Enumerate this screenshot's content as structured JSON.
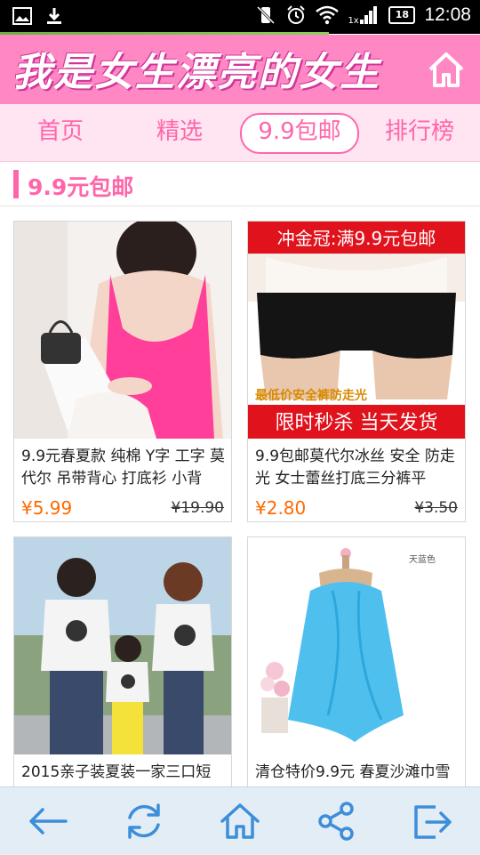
{
  "status_bar": {
    "time": "12:08",
    "battery": "18",
    "network_label": "1x",
    "icons": [
      "image-icon",
      "download-icon",
      "vibrate-off-icon",
      "alarm-icon",
      "wifi-icon",
      "signal-icon",
      "battery-icon"
    ]
  },
  "header": {
    "title": "我是女生漂亮的女生",
    "home_icon": "home-icon"
  },
  "tabs": [
    {
      "label": "首页",
      "active": false
    },
    {
      "label": "精选",
      "active": false
    },
    {
      "label": "9.9包邮",
      "active": true
    },
    {
      "label": "排行榜",
      "active": false
    }
  ],
  "section": {
    "title": "9.9元包邮"
  },
  "products": [
    {
      "title": "9.9元春夏款 纯棉 Y字 工字 莫代尔 吊带背心 打底衫 小背",
      "price": "¥5.99",
      "original_price": "¥19.90",
      "image": "pink-tank-top"
    },
    {
      "title": "9.9包邮莫代尔冰丝 安全 防走光 女士蕾丝打底三分裤平",
      "price": "¥2.80",
      "original_price": "¥3.50",
      "image": "black-safety-shorts",
      "banner_top": "冲金冠:满9.9元包邮",
      "banner_tag": "最低价安全裤防走光",
      "banner_bottom": "限时秒杀 当天发货"
    },
    {
      "title": "2015亲子装夏装一家三口短",
      "image": "family-tshirts"
    },
    {
      "title": "清仓特价9.9元 春夏沙滩巾雪",
      "image": "blue-scarf",
      "image_caption": "天蓝色"
    }
  ],
  "bottom_nav": [
    {
      "name": "back",
      "icon": "arrow-left-icon"
    },
    {
      "name": "refresh",
      "icon": "refresh-icon"
    },
    {
      "name": "home",
      "icon": "home-icon"
    },
    {
      "name": "share",
      "icon": "share-icon"
    },
    {
      "name": "exit",
      "icon": "exit-icon"
    }
  ],
  "colors": {
    "brand_pink": "#ff88c4",
    "accent_pink": "#ff66aa",
    "price_orange": "#ff6a00",
    "nav_blue": "#3d8ed8"
  }
}
